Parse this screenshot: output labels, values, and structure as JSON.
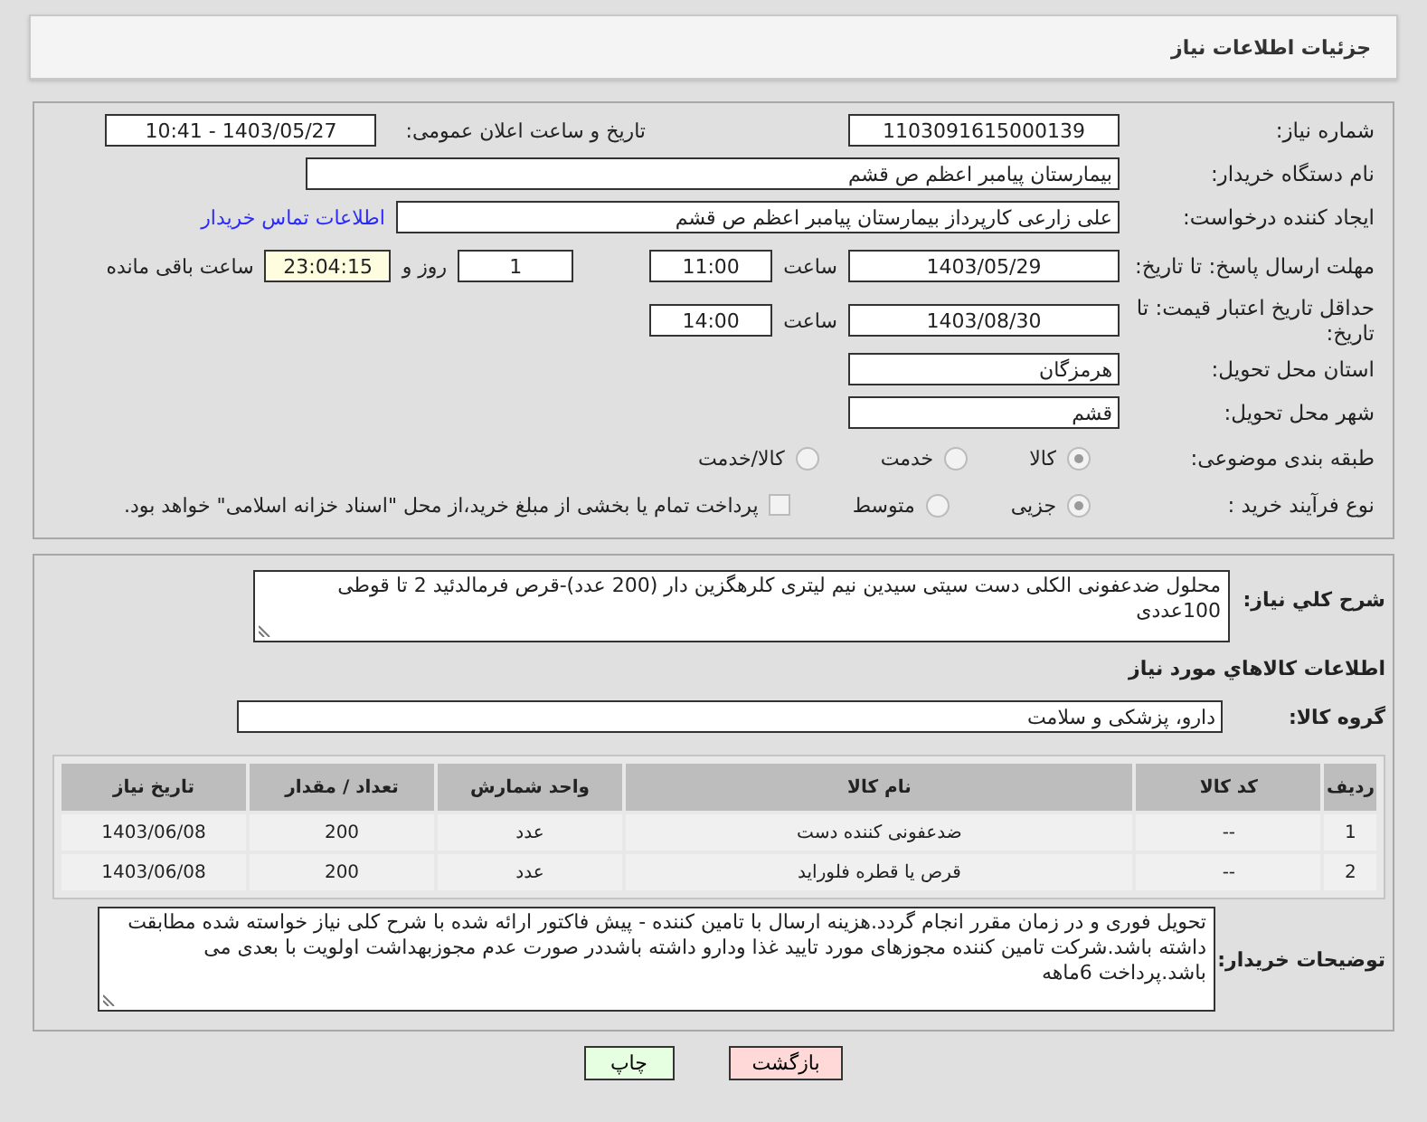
{
  "header": {
    "title": "جزئیات اطلاعات نیاز"
  },
  "details": {
    "need_number": {
      "label": "شماره نیاز:",
      "value": "1103091615000139"
    },
    "announce": {
      "label": "تاریخ و ساعت اعلان عمومی:",
      "value": "1403/05/27 - 10:41"
    },
    "buyer_org": {
      "label": "نام دستگاه خریدار:",
      "value": "بیمارستان پیامبر اعظم  ص  قشم"
    },
    "requester": {
      "label": "ایجاد کننده درخواست:",
      "value": "علی زارعی کارپرداز بیمارستان پیامبر اعظم  ص  قشم",
      "link": "اطلاعات تماس خریدار"
    },
    "deadline": {
      "label": "مهلت ارسال پاسخ: تا تاریخ:",
      "date": "1403/05/29",
      "time_label": "ساعت",
      "time": "11:00",
      "days": "1",
      "days_label": "روز و",
      "remaining": "23:04:15",
      "remaining_label": "ساعت باقی مانده"
    },
    "validity": {
      "label": "حداقل تاریخ اعتبار قیمت: تا تاریخ:",
      "date": "1403/08/30",
      "time_label": "ساعت",
      "time": "14:00"
    },
    "province": {
      "label": "استان محل تحویل:",
      "value": "هرمزگان"
    },
    "city": {
      "label": "شهر محل تحویل:",
      "value": "قشم"
    },
    "category": {
      "label": "طبقه بندی موضوعی:",
      "options": [
        {
          "label": "کالا",
          "selected": true
        },
        {
          "label": "خدمت",
          "selected": false
        },
        {
          "label": "کالا/خدمت",
          "selected": false
        }
      ]
    },
    "purchase_type": {
      "label": "نوع فرآیند خرید :",
      "options": [
        {
          "label": "جزیی",
          "selected": true
        },
        {
          "label": "متوسط",
          "selected": false
        }
      ],
      "payment": {
        "label": "پرداخت تمام یا بخشی از مبلغ خرید،از محل \"اسناد خزانه اسلامی\" خواهد بود.",
        "checked": false
      }
    }
  },
  "goods": {
    "description": {
      "label": "شرح کلي نياز:",
      "value": "محلول ضدعفونی الکلی دست سیتی سیدین نیم لیتری کلرهگزین دار (200 عدد)-قرص فرمالدئید 2 تا قوطی 100عددی"
    },
    "section_title": "اطلاعات کالاهاي مورد نياز",
    "group": {
      "label": "گروه کالا:",
      "value": "دارو، پزشکی و سلامت"
    },
    "table": {
      "columns": [
        "ردیف",
        "کد کالا",
        "نام کالا",
        "واحد شمارش",
        "تعداد / مقدار",
        "تاریخ نیاز"
      ],
      "rows": [
        [
          "1",
          "--",
          "ضدعفونی کننده دست",
          "عدد",
          "200",
          "1403/06/08"
        ],
        [
          "2",
          "--",
          "قرص یا قطره فلوراید",
          "عدد",
          "200",
          "1403/06/08"
        ]
      ]
    },
    "notes": {
      "label": "توضیحات خریدار:",
      "value": "تحویل فوری و در زمان مقرر انجام گردد.هزینه ارسال با تامین کننده - پیش فاکتور ارائه شده با شرح کلی نیاز خواسته شده مطابقت داشته باشد.شرکت تامین کننده مجوزهای مورد تایید غذا ودارو داشته باشددر صورت عدم مجوزبهداشت اولویت با بعدی می باشد.پرداخت  6ماهه"
    }
  },
  "buttons": [
    {
      "label": "بازگشت",
      "kind": "back"
    },
    {
      "label": "چاپ",
      "kind": "print"
    }
  ]
}
